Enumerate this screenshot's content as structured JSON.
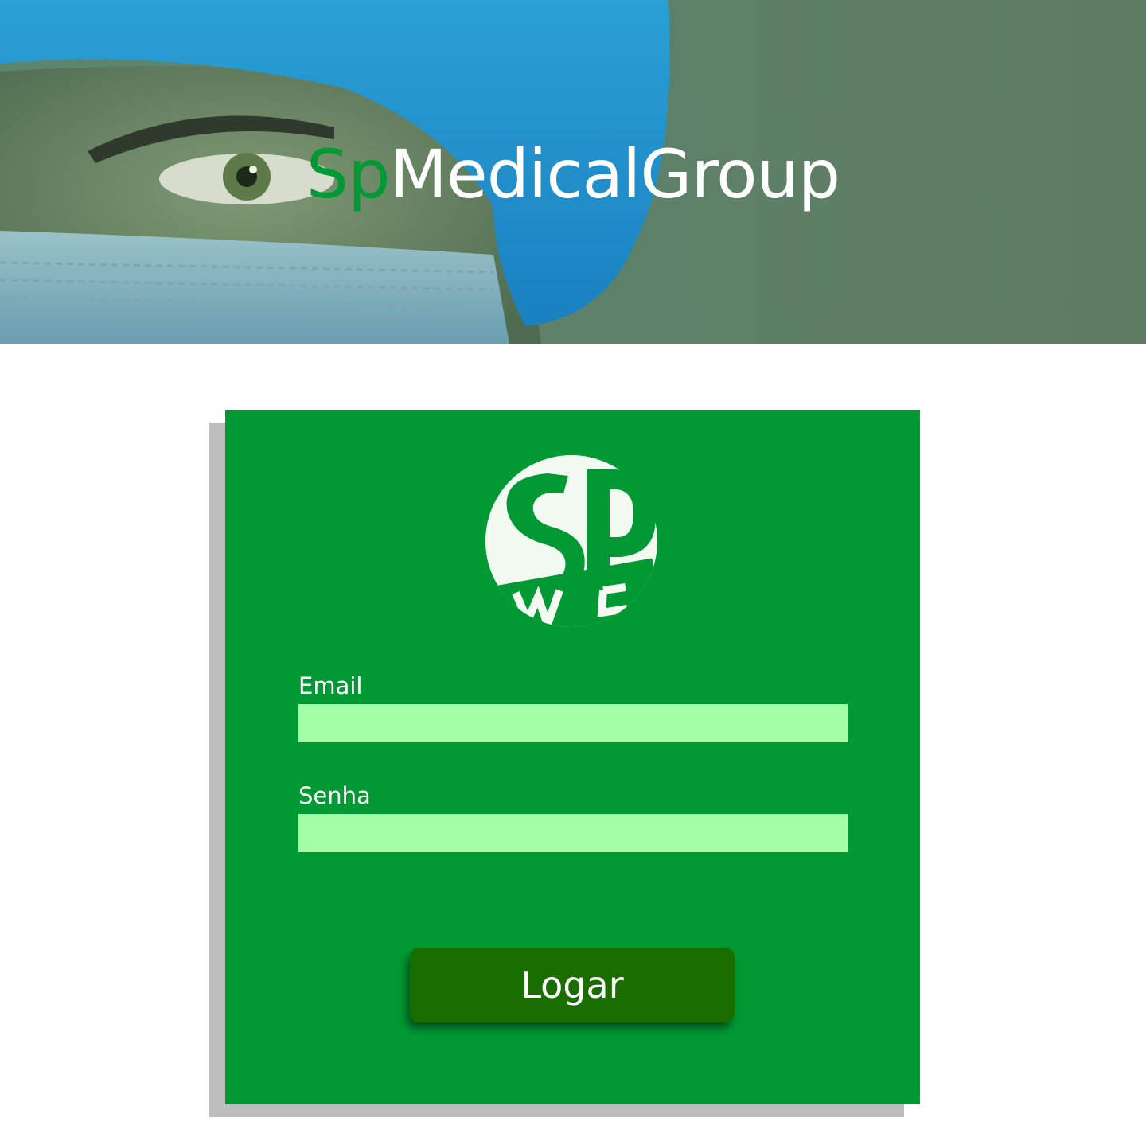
{
  "header": {
    "title_prefix": "Sp",
    "title_rest": "MedicalGroup"
  },
  "login": {
    "email_label": "Email",
    "email_value": "",
    "password_label": "Senha",
    "password_value": "",
    "submit_label": "Logar"
  },
  "colors": {
    "brand_green": "#009933",
    "input_bg": "#a2ffa5",
    "button_bg": "#1a6e00"
  },
  "icons": {
    "logo": "sp-medical-group-logo"
  }
}
